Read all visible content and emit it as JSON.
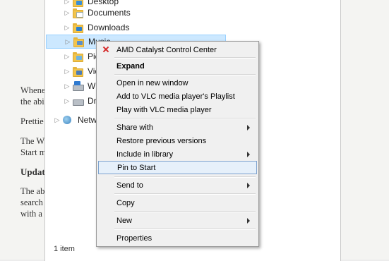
{
  "background_article": {
    "lines": [
      "Whene",
      "the abi",
      "Prettie",
      "The Wi",
      "Start m",
      "Updat",
      "The ab",
      "search",
      "with a"
    ]
  },
  "explorer": {
    "tree": [
      {
        "label": "Desktop",
        "icon": "desktop-folder-icon"
      },
      {
        "label": "Documents",
        "icon": "documents-folder-icon"
      },
      {
        "label": "Downloads",
        "icon": "downloads-folder-icon"
      },
      {
        "label": "Music",
        "icon": "music-folder-icon"
      },
      {
        "label": "Pict",
        "icon": "pictures-folder-icon"
      },
      {
        "label": "Vid",
        "icon": "videos-folder-icon"
      },
      {
        "label": "Wir",
        "icon": "windows-drive-icon"
      },
      {
        "label": "Driv",
        "icon": "drive-icon"
      },
      {
        "label": "Netwo",
        "icon": "network-icon"
      }
    ],
    "status": "1 item"
  },
  "context_menu": {
    "items": [
      {
        "label": "AMD Catalyst Control Center",
        "icon": "amd-icon"
      },
      {
        "label": "Expand",
        "bold": true
      },
      {
        "label": "Open in new window"
      },
      {
        "label": "Add to VLC media player's Playlist"
      },
      {
        "label": "Play with VLC media player"
      },
      {
        "label": "Share with",
        "submenu": true
      },
      {
        "label": "Restore previous versions"
      },
      {
        "label": "Include in library",
        "submenu": true
      },
      {
        "label": "Pin to Start",
        "highlighted": true
      },
      {
        "label": "Send to",
        "submenu": true
      },
      {
        "label": "Copy"
      },
      {
        "label": "New",
        "submenu": true
      },
      {
        "label": "Properties"
      }
    ]
  },
  "colors": {
    "selection": "#cce8ff",
    "menu_highlight": "#e6f0fa",
    "menu_highlight_border": "#7da2ce"
  }
}
